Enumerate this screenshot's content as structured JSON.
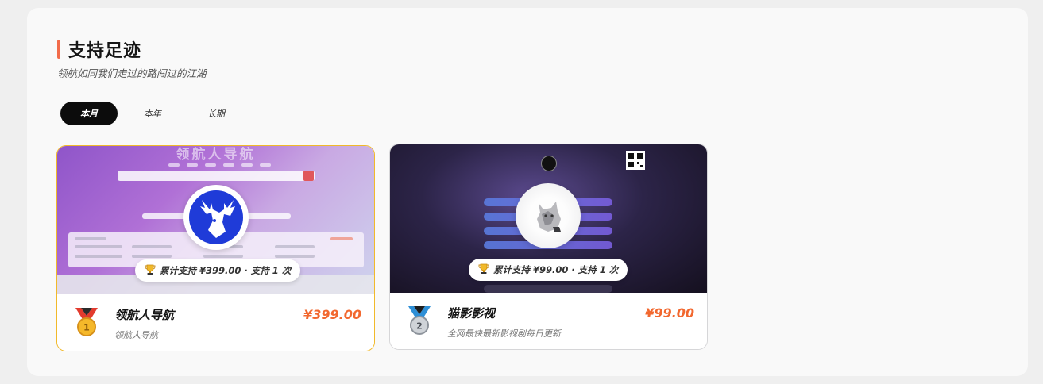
{
  "section": {
    "title": "支持足迹",
    "subtitle": "领航如同我们走过的路闯过的江湖",
    "accent_color": "#f26b4a"
  },
  "tabs": [
    {
      "label": "本月",
      "active": true
    },
    {
      "label": "本年",
      "active": false
    },
    {
      "label": "长期",
      "active": false
    }
  ],
  "cards": [
    {
      "rank": 1,
      "medal": "gold-medal-icon",
      "banner_title": "领航人导航",
      "support_text": "累计支持 ¥399.00 · 支持 1 次",
      "name": "领航人导航",
      "description": "领航人导航",
      "price": "¥399.00",
      "border_color": "#f1b92a"
    },
    {
      "rank": 2,
      "medal": "silver-medal-icon",
      "support_text": "累计支持 ¥99.00 · 支持 1 次",
      "name": "猫影影视",
      "description": "全网最快最新影视剧每日更新",
      "price": "¥99.00",
      "border_color": "#d6d6d8"
    }
  ],
  "colors": {
    "price": "#f2682f",
    "gold": "#f1b92a",
    "tab_active_bg": "#0c0c0c"
  }
}
